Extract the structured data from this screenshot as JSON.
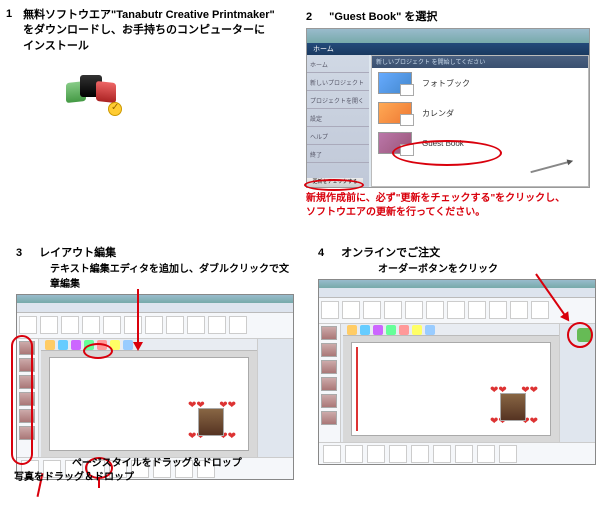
{
  "steps": {
    "s1": {
      "num": "1",
      "line1": "無料ソフトウエア\"Tanabutr Creative Printmaker\"",
      "line2": "をダウンロードし、お手持ちのコンピューターに",
      "line3": "インストール"
    },
    "s2": {
      "num": "2",
      "title": "\"Guest Book\" を選択",
      "menubar": "ホーム",
      "mainbar": "新しいプロジェクト を開始してください",
      "side_items": [
        "ホーム",
        "新しいプロジェクト",
        "プロジェクトを開く",
        "設定",
        "ヘルプ",
        "終了"
      ],
      "items": [
        {
          "label": "フォトブック"
        },
        {
          "label": "カレンダ"
        },
        {
          "label": "Guest Book"
        }
      ],
      "update_btn": "更新をチェックする",
      "note1": "新規作成前に、必ず\"更新をチェックする\"をクリックし、",
      "note2": "ソフトウエアの更新を行ってください。"
    },
    "s3": {
      "num": "3",
      "title": "レイアウト編集",
      "sub": "テキスト編集エディタを追加し、ダブルクリックで文章編集",
      "note_pagestyle": "ページスタイルをドラッグ＆ドロップ",
      "note_photo": "写真をドラッグ＆ドロップ"
    },
    "s4": {
      "num": "4",
      "title": "オンラインでご注文",
      "sub": "オーダーボタンをクリック"
    }
  }
}
